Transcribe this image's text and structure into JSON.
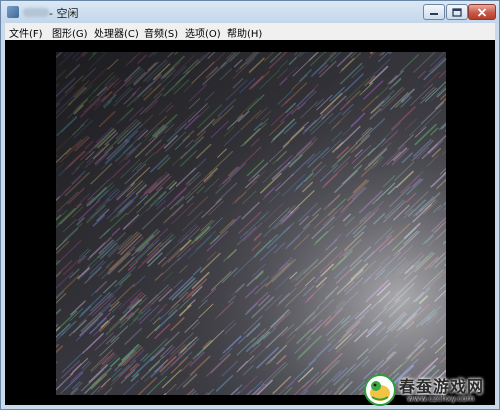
{
  "window": {
    "title": "- 空闲"
  },
  "menubar": {
    "items": [
      {
        "label": "文件(F)"
      },
      {
        "label": "图形(G)"
      },
      {
        "label": "处理器(C)"
      },
      {
        "label": "音频(S)"
      },
      {
        "label": "选项(O)"
      },
      {
        "label": "帮助(H)"
      }
    ]
  },
  "canvas": {
    "content": "noise-render",
    "background_color": "#000000"
  },
  "watermark": {
    "name": "春蚕游戏网",
    "url": "www.czchxy.com"
  },
  "icons": {
    "minimize": "minimize-icon",
    "maximize": "maximize-icon",
    "close": "close-icon",
    "app": "app-icon"
  }
}
